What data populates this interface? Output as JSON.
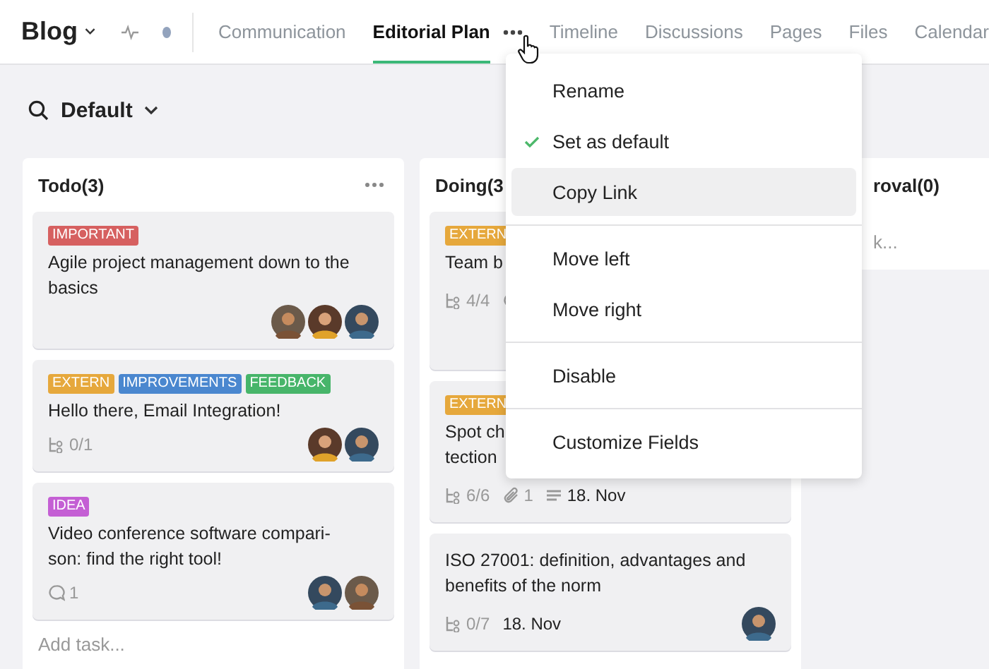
{
  "header": {
    "project": "Blog",
    "tabs": [
      {
        "label": "Communication",
        "selected": false
      },
      {
        "label": "Editorial Plan",
        "selected": true
      },
      {
        "label": "Timeline",
        "selected": false
      },
      {
        "label": "Discussions",
        "selected": false
      },
      {
        "label": "Pages",
        "selected": false
      },
      {
        "label": "Files",
        "selected": false
      },
      {
        "label": "Calendar",
        "selected": false
      }
    ]
  },
  "view": {
    "name": "Default"
  },
  "columns": [
    {
      "title": "Todo(3)",
      "add_task": "Add task...",
      "cards": [
        {
          "tags": [
            {
              "label": "IMPORTANT",
              "color": "#d66060"
            }
          ],
          "title": "Agile project management down to the basics",
          "avatars": [
            {
              "kind": "picture"
            },
            {
              "kind": "picture"
            },
            {
              "kind": "picture"
            }
          ]
        },
        {
          "tags": [
            {
              "label": "EXTERN",
              "color": "#e6a83c"
            },
            {
              "label": "IMPROVEMENTS",
              "color": "#4a87cf"
            },
            {
              "label": "FEEDBACK",
              "color": "#47b56a"
            }
          ],
          "title": "Hello there, Email Integration!",
          "meta": [
            {
              "kind": "subtasks",
              "text": "0/1"
            }
          ],
          "avatars": [
            {
              "kind": "picture"
            },
            {
              "kind": "picture"
            }
          ]
        },
        {
          "tags": [
            {
              "label": "IDEA",
              "color": "#c45fd4"
            }
          ],
          "title": "Video conference software compari-son: find the right tool!",
          "meta": [
            {
              "kind": "comments",
              "text": "1"
            }
          ],
          "avatars": [
            {
              "kind": "picture"
            },
            {
              "kind": "picture"
            }
          ]
        }
      ]
    },
    {
      "title": "Doing(3",
      "cards": [
        {
          "tags": [
            {
              "label": "EXTERN",
              "color": "#e6a83c"
            }
          ],
          "title": "Team b",
          "meta": [
            {
              "kind": "subtasks",
              "text": "4/4"
            },
            {
              "kind": "comments"
            }
          ]
        },
        {
          "tags": [
            {
              "label": "EXTERN",
              "color": "#e6a83c"
            }
          ],
          "title": "Spot ch\ntection",
          "meta": [
            {
              "kind": "subtasks",
              "text": "6/6"
            },
            {
              "kind": "attachments",
              "text": "1"
            },
            {
              "kind": "description"
            },
            {
              "kind": "date",
              "text": "18. Nov"
            }
          ]
        },
        {
          "title": "ISO 27001: definition, advantages and benefits of the norm",
          "meta": [
            {
              "kind": "subtasks",
              "text": "0/7"
            },
            {
              "kind": "date",
              "text": "18. Nov"
            }
          ],
          "avatars": [
            {
              "kind": "picture"
            }
          ]
        }
      ]
    },
    {
      "title": "roval(0)",
      "add_task": "k..."
    }
  ],
  "menu": {
    "groups": [
      [
        {
          "label": "Rename",
          "checked": false,
          "highlighted": false
        },
        {
          "label": "Set as default",
          "checked": true,
          "highlighted": false
        },
        {
          "label": "Copy Link",
          "checked": false,
          "highlighted": true
        }
      ],
      [
        {
          "label": "Move left",
          "checked": false,
          "highlighted": false
        },
        {
          "label": "Move right",
          "checked": false,
          "highlighted": false
        }
      ],
      [
        {
          "label": "Disable",
          "checked": false,
          "highlighted": false
        }
      ],
      [
        {
          "label": "Customize Fields",
          "checked": false,
          "highlighted": false
        }
      ]
    ]
  }
}
